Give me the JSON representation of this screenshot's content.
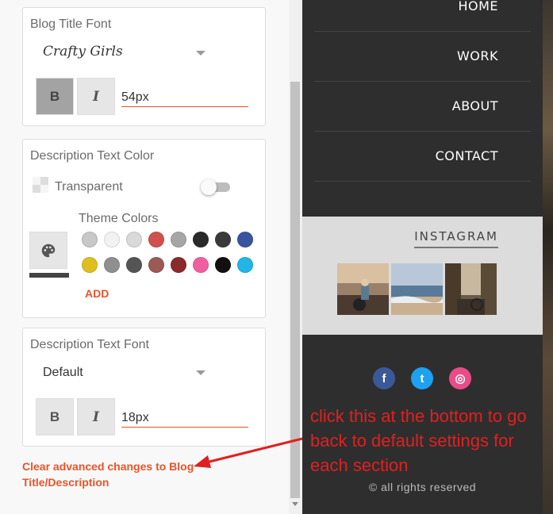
{
  "panel": {
    "blog_title_font": {
      "title": "Blog Title Font",
      "font": "Crafty Girls",
      "bold_label": "B",
      "italic_label": "I",
      "size": "54px"
    },
    "description_color": {
      "title": "Description Text Color",
      "transparent_label": "Transparent",
      "theme_label": "Theme Colors",
      "add_label": "ADD",
      "swatches": [
        "#c8c8c8",
        "#f2f2f2",
        "#d9d9d9",
        "#d05050",
        "#a6a6a6",
        "#2a2a2a",
        "#3a3a3a",
        "#3a55a0",
        "#ddc020",
        "#8f8f8f",
        "#555555",
        "#9a5a55",
        "#8a2a2a",
        "#f060a0",
        "#111111",
        "#22b5e5"
      ]
    },
    "description_font": {
      "title": "Description Text Font",
      "font": "Default",
      "bold_label": "B",
      "italic_label": "I",
      "size": "18px"
    },
    "clear_link": "Clear advanced changes to Blog Title/Description"
  },
  "preview": {
    "nav": [
      "HOME",
      "WORK",
      "ABOUT",
      "CONTACT"
    ],
    "instagram_title": "INSTAGRAM",
    "social": [
      {
        "icon": "facebook-icon",
        "glyph": "f",
        "color": "#3b5998"
      },
      {
        "icon": "twitter-icon",
        "glyph": "t",
        "color": "#1da1f2"
      },
      {
        "icon": "dribbble-icon",
        "glyph": "◎",
        "color": "#ea4c89"
      }
    ],
    "rights": "© all rights reserved"
  },
  "annotation": "click this at the bottom to go back to default settings for each section",
  "accent_color": "#e8542a"
}
